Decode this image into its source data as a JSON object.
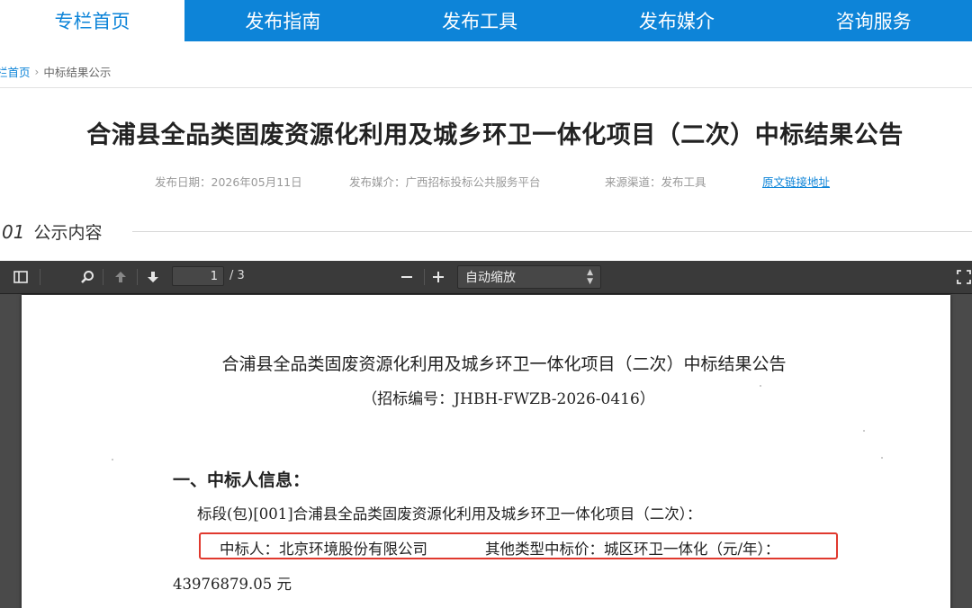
{
  "nav": {
    "tabs": [
      {
        "label": "专栏首页",
        "active": true
      },
      {
        "label": "发布指南"
      },
      {
        "label": "发布工具"
      },
      {
        "label": "发布媒介"
      },
      {
        "label": "咨询服务"
      }
    ]
  },
  "breadcrumb": {
    "home": "栏首页",
    "separator": "›",
    "current": "中标结果公示"
  },
  "article": {
    "title": "合浦县全品类固废资源化利用及城乡环卫一体化项目（二次）中标结果公告",
    "publish_date": "发布日期：2026年05月11日",
    "publish_media": "发布媒介：广西招标投标公共服务平台",
    "source": "来源渠道：发布工具",
    "original_link": "原文链接地址"
  },
  "section": {
    "number": "01",
    "label": "公示内容"
  },
  "viewer": {
    "current_page": "1",
    "total_pages": "/ 3",
    "zoom": "自动缩放",
    "icons": [
      "sidebar-toggle-icon",
      "search-icon",
      "previous-page-icon",
      "next-page-icon",
      "zoom-out-icon",
      "zoom-in-icon",
      "fullscreen-icon"
    ]
  },
  "document": {
    "title": "合浦县全品类固废资源化利用及城乡环卫一体化项目（二次）中标结果公告",
    "bid_number": "（招标编号：JHBH-FWZB-2026-0416）",
    "heading1": "一、中标人信息：",
    "lot": "标段(包)[001]合浦县全品类固废资源化利用及城乡环卫一体化项目（二次）：",
    "winner": "中标人：北京环境股份有限公司",
    "price_label": "其他类型中标价：城区环卫一体化（元/年）：",
    "amount": "43976879.05 元"
  },
  "colors": {
    "brand_blue": "#0d84d8",
    "highlight_red": "#e0392e",
    "viewer_bg": "#4a4a4a"
  }
}
